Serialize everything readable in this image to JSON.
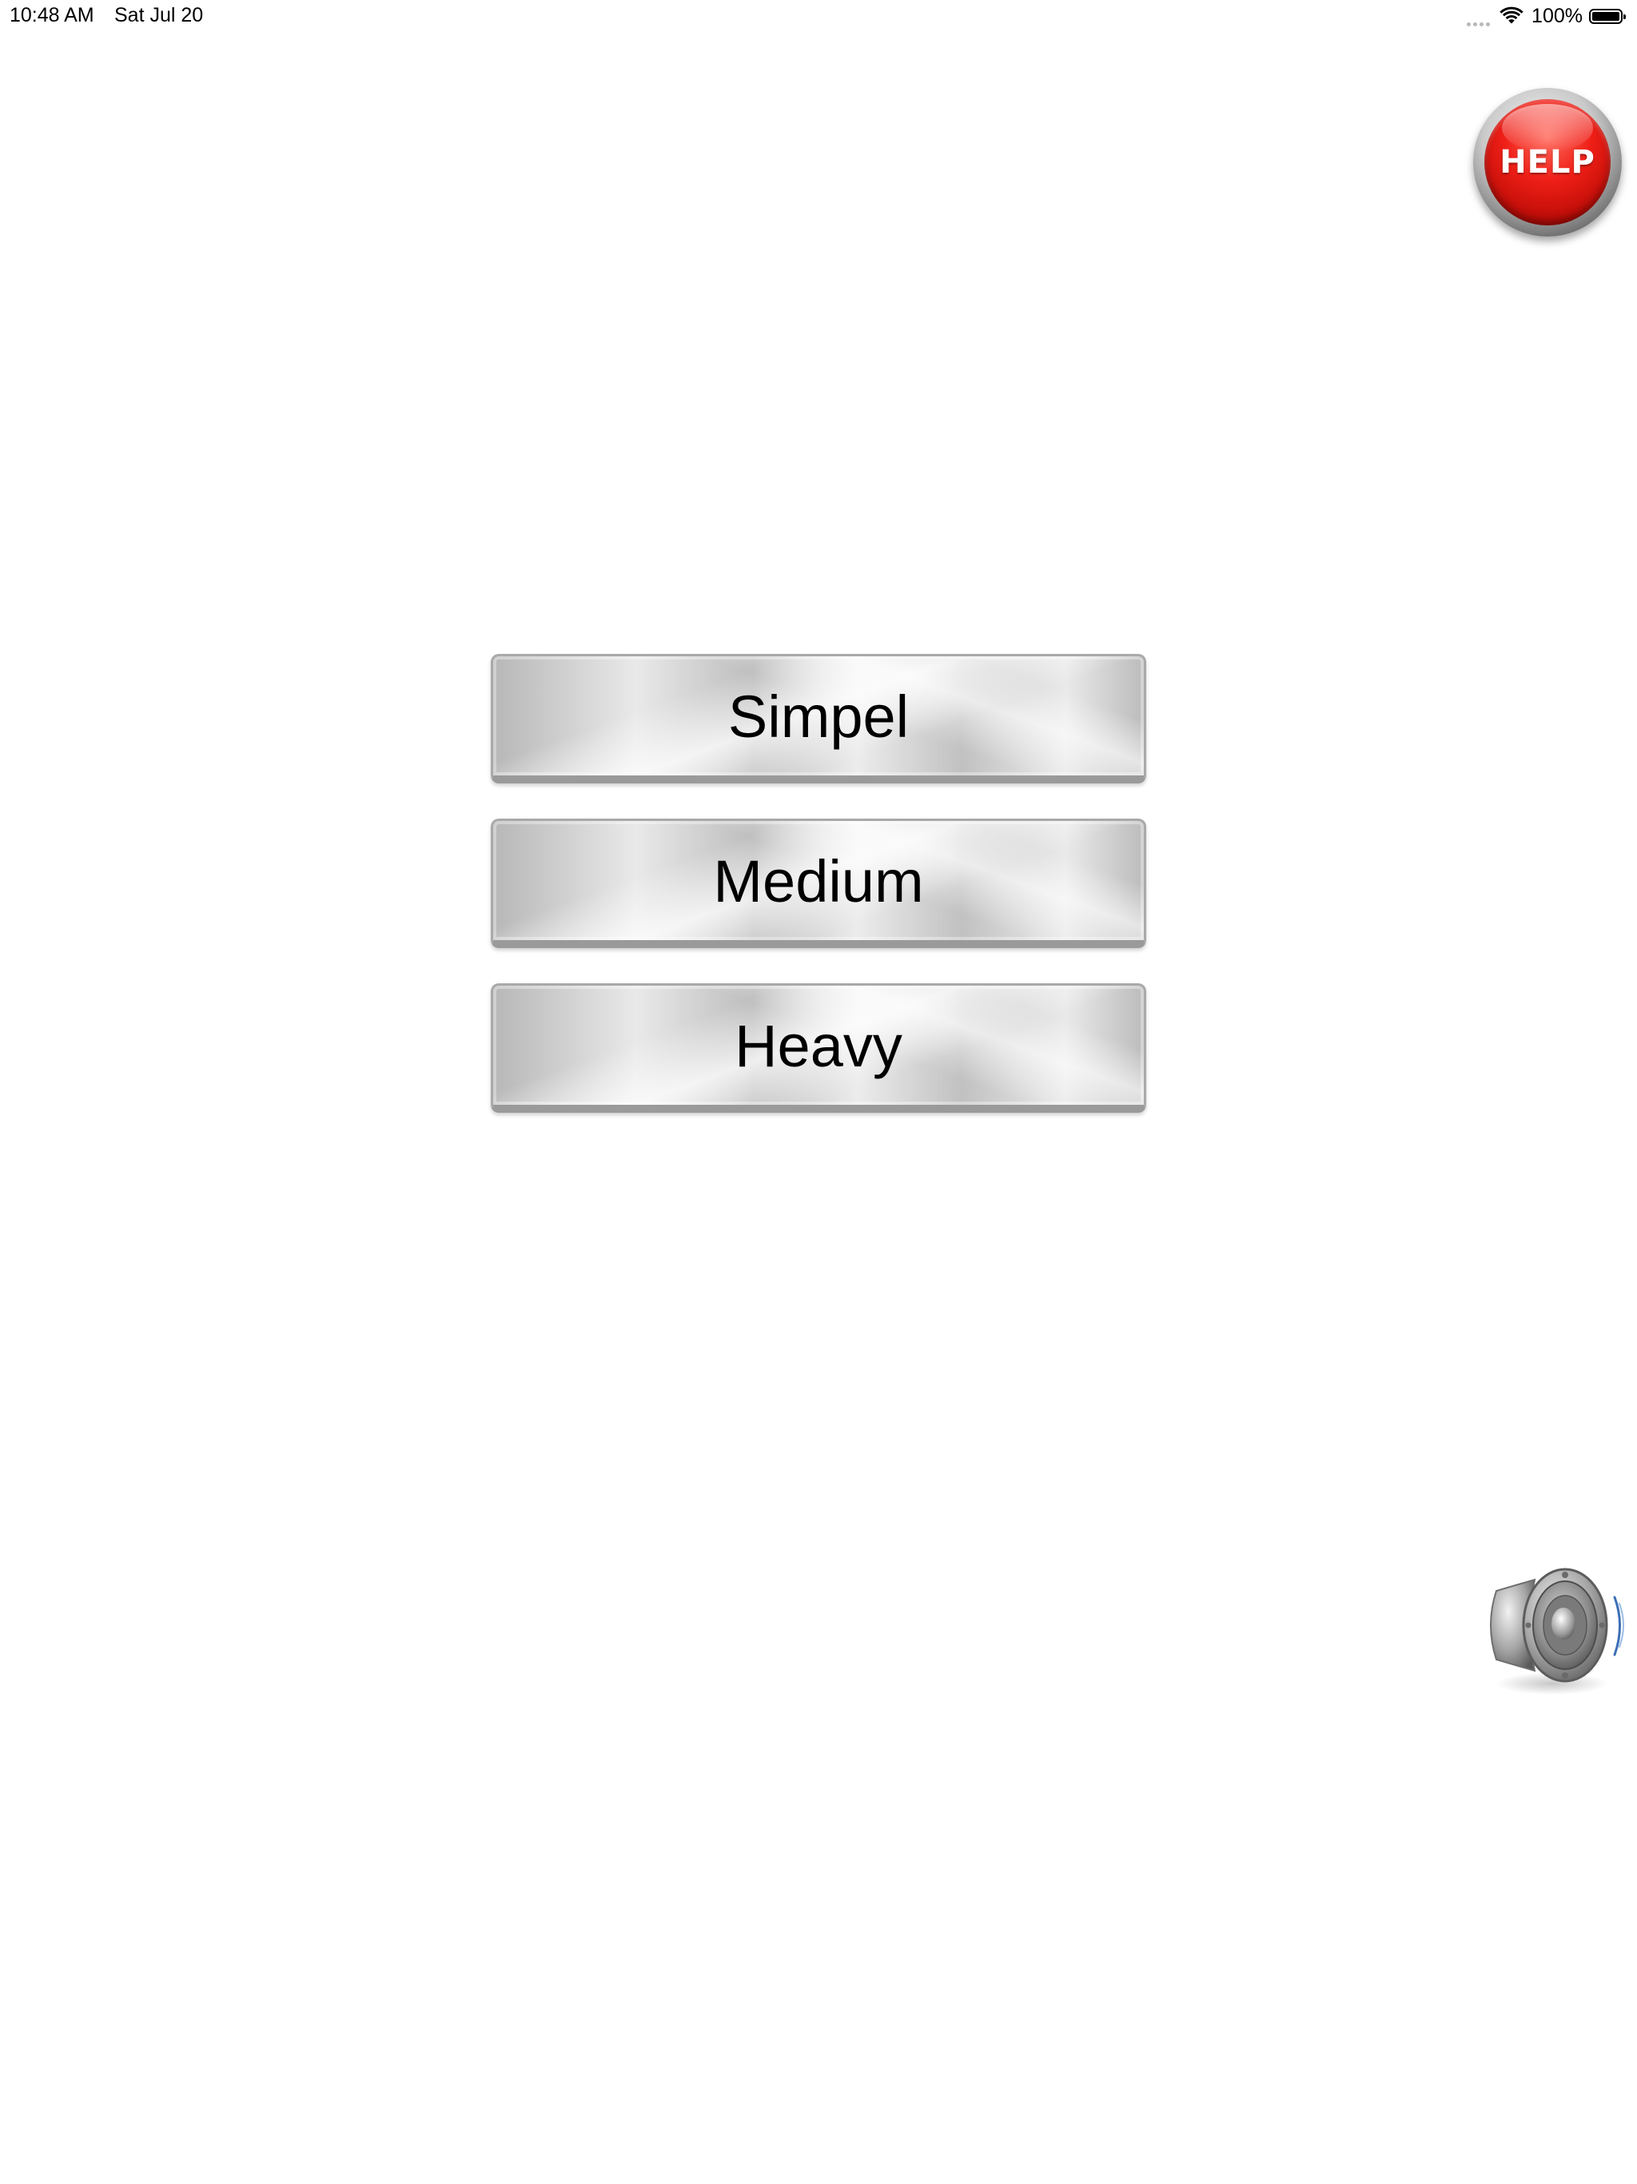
{
  "status_bar": {
    "time": "10:48 AM",
    "date": "Sat Jul 20",
    "battery": "100%",
    "battery_level": 1.0,
    "icons": [
      "signal-dots-icon",
      "wifi-icon",
      "battery-icon"
    ]
  },
  "help_button": {
    "label": "HELP",
    "icon": "help-icon",
    "color": "#e8140f"
  },
  "difficulty": {
    "options": [
      {
        "label": "Simpel"
      },
      {
        "label": "Medium"
      },
      {
        "label": "Heavy"
      }
    ]
  },
  "sound_button": {
    "icon": "speaker-icon"
  }
}
